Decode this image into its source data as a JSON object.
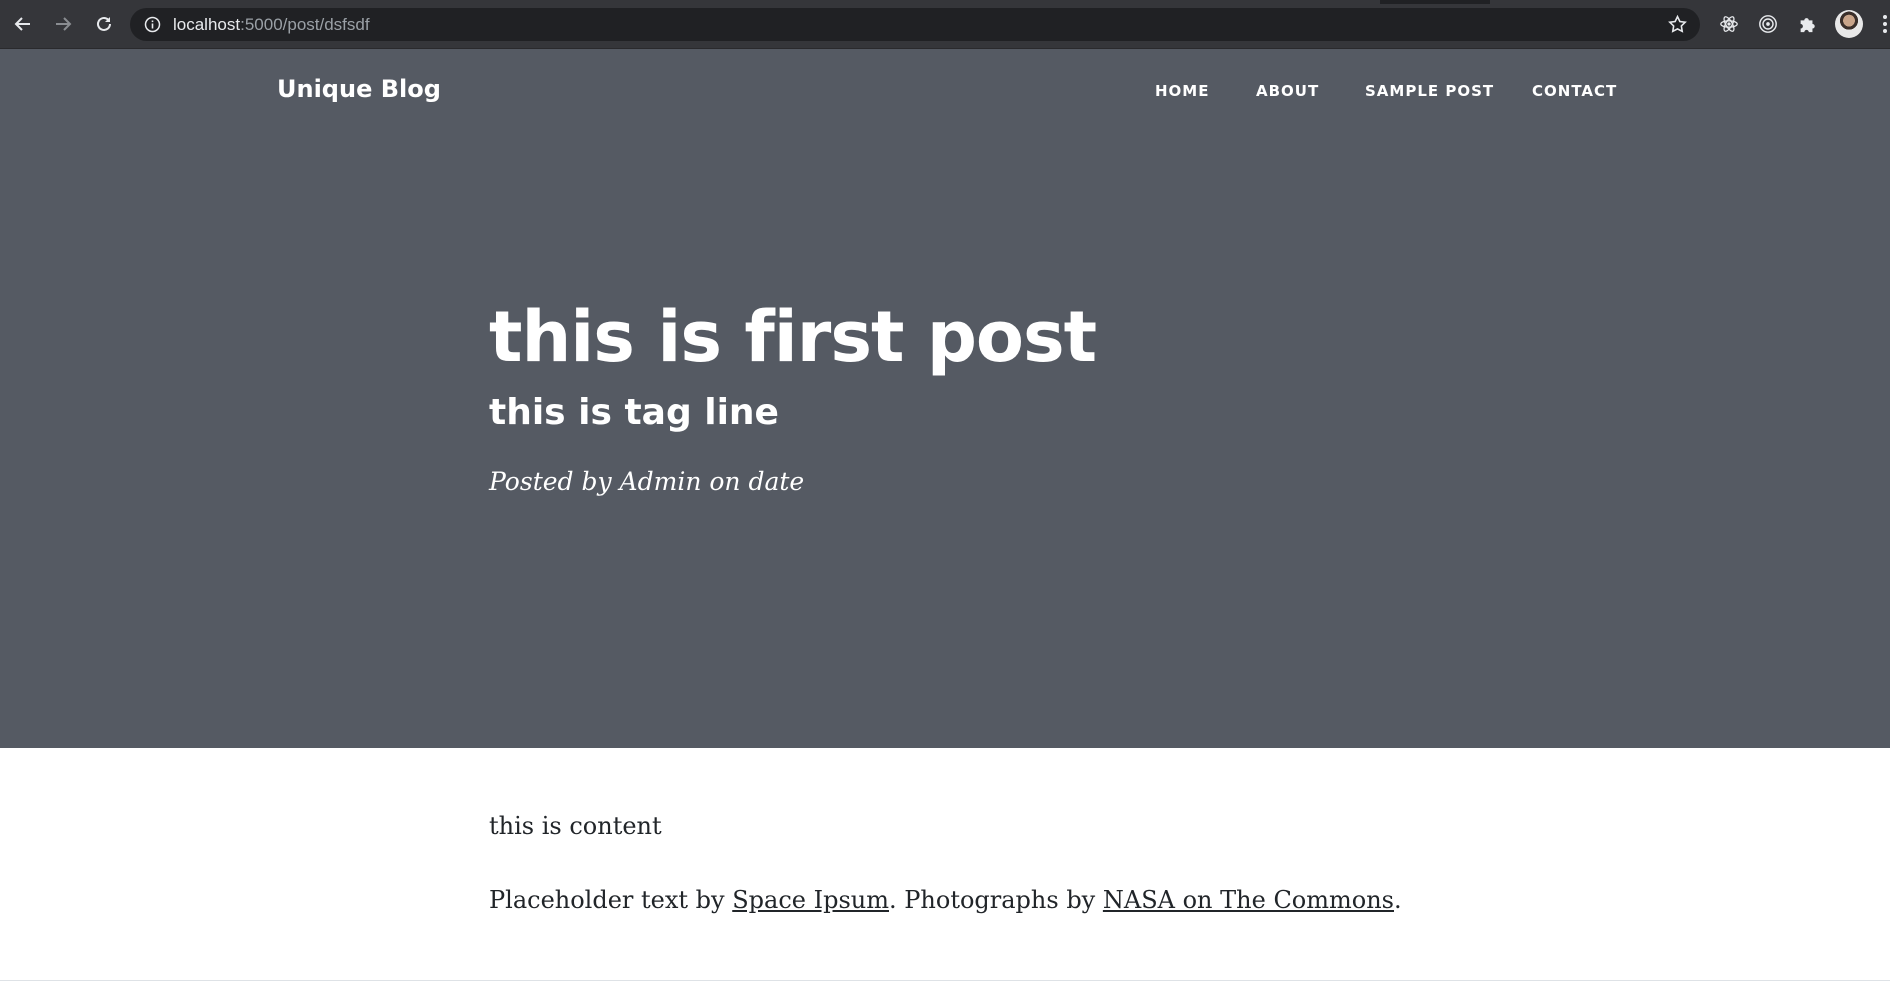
{
  "browser": {
    "url_host": "localhost",
    "url_rest": ":5000/post/dsfsdf"
  },
  "site": {
    "brand": "Unique Blog",
    "nav": [
      {
        "label": "HOME"
      },
      {
        "label": "ABOUT"
      },
      {
        "label": "SAMPLE POST"
      },
      {
        "label": "CONTACT"
      }
    ],
    "header_bg": "#555a63"
  },
  "post": {
    "title": "this is first post",
    "subtitle": "this is tag line",
    "meta": "Posted by Admin on date",
    "content": "this is content",
    "credits": {
      "prefix": "Placeholder text by ",
      "link1": "Space Ipsum",
      "middle": ". Photographs by ",
      "link2": "NASA on The Commons",
      "suffix": "."
    }
  }
}
